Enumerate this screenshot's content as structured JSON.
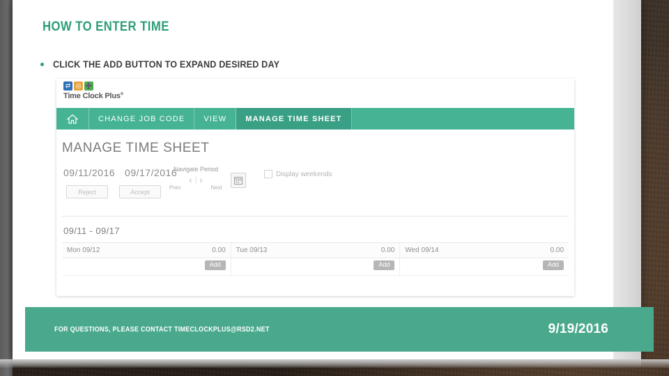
{
  "slide": {
    "title": "HOW TO ENTER TIME",
    "bullet": "CLICK THE ADD BUTTON TO EXPAND DESIRED DAY",
    "accent_color": "#2e9d79",
    "footer": {
      "contact": "FOR QUESTIONS, PLEASE CONTACT TIMECLOCKPLUS@RSD2.NET",
      "date": "9/19/2016",
      "background_color": "#4aa98d"
    }
  },
  "screenshot": {
    "logo": {
      "tiles": [
        "⇄",
        "◎",
        "➕"
      ],
      "text": "Time Clock Plus",
      "superscript": "®"
    },
    "nav": {
      "home_icon": "home-icon",
      "items": [
        {
          "label": "CHANGE JOB CODE",
          "active": false
        },
        {
          "label": "VIEW",
          "active": false
        },
        {
          "label": "MANAGE TIME SHEET",
          "active": true
        }
      ],
      "background_color": "#45b394"
    },
    "page_heading": "MANAGE TIME SHEET",
    "date_start": "09/11/2016",
    "date_end": "09/17/2016",
    "buttons": {
      "reject": "Reject",
      "accept": "Accept"
    },
    "navigate_period": {
      "label": "Navigate Period",
      "prev": "Prev",
      "next": "Next",
      "prev_arrow": "‹",
      "next_arrow": "›",
      "calendar_icon": "calendar-icon"
    },
    "display_weekends": {
      "label": "Display weekends",
      "checked": false
    },
    "week_label": "09/11 - 09/17",
    "days": [
      {
        "name": "Mon 09/12",
        "hours": "0.00",
        "add_label": "Add",
        "highlighted": true
      },
      {
        "name": "Tue 09/13",
        "hours": "0.00",
        "add_label": "Add",
        "highlighted": false
      },
      {
        "name": "Wed 09/14",
        "hours": "0.00",
        "add_label": "Add",
        "highlighted": false
      }
    ],
    "highlight_color": "#d83a2e",
    "cursor": "hand-pointer-cursor"
  }
}
